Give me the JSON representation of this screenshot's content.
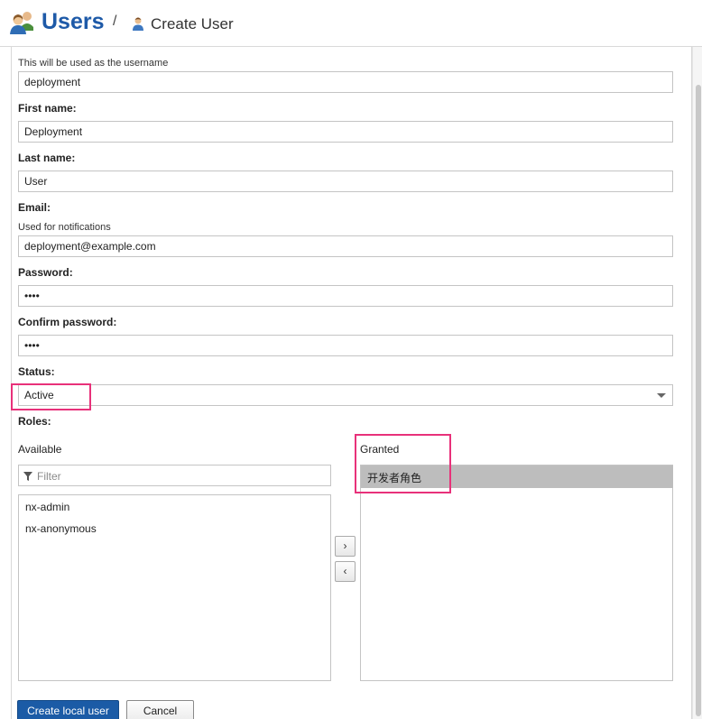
{
  "header": {
    "title": "Users",
    "separator": "/",
    "current": "Create User",
    "accent": "#1e5aa8"
  },
  "form": {
    "username_help": "This will be used as the username",
    "username_value": "deployment",
    "first_name_label": "First name:",
    "first_name_value": "Deployment",
    "last_name_label": "Last name:",
    "last_name_value": "User",
    "email_label": "Email:",
    "email_help": "Used for notifications",
    "email_value": "deployment@example.com",
    "password_label": "Password:",
    "password_value": "••••",
    "confirm_label": "Confirm password:",
    "confirm_value": "••••",
    "status_label": "Status:",
    "status_value": "Active",
    "roles_label": "Roles:"
  },
  "roles": {
    "available_label": "Available",
    "filter_placeholder": "Filter",
    "available_items": [
      "nx-admin",
      "nx-anonymous"
    ],
    "granted_label": "Granted",
    "granted_items": [
      "开发者角色"
    ],
    "add_arrow": "›",
    "remove_arrow": "‹"
  },
  "actions": {
    "create_label": "Create local user",
    "cancel_label": "Cancel",
    "primary_color": "#1b5ba6"
  },
  "highlight_color": "#e8317a"
}
